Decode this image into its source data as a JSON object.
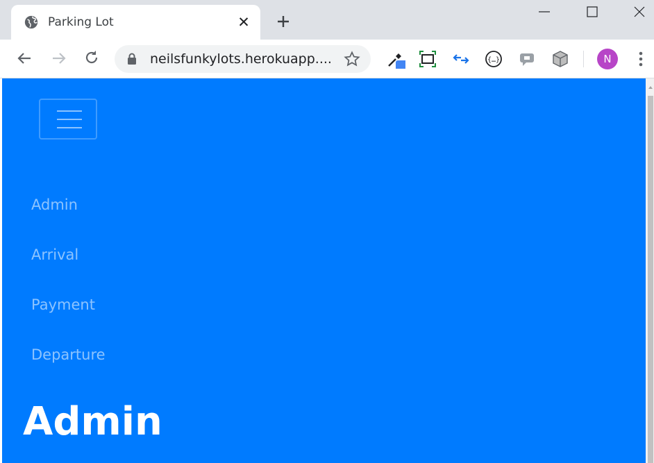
{
  "browser": {
    "tab_title": "Parking Lot",
    "tab_close": "✕",
    "url": "neilsfunkylots.herokuapp....",
    "profile_initial": "N",
    "colors": {
      "tabbar": "#dee1e6",
      "avatar": "#b745c7"
    }
  },
  "page": {
    "nav": {
      "links": [
        {
          "label": "Admin"
        },
        {
          "label": "Arrival"
        },
        {
          "label": "Payment"
        },
        {
          "label": "Departure"
        }
      ]
    },
    "title": "Admin",
    "colors": {
      "background": "#007bff",
      "text": "#ffffff"
    }
  }
}
